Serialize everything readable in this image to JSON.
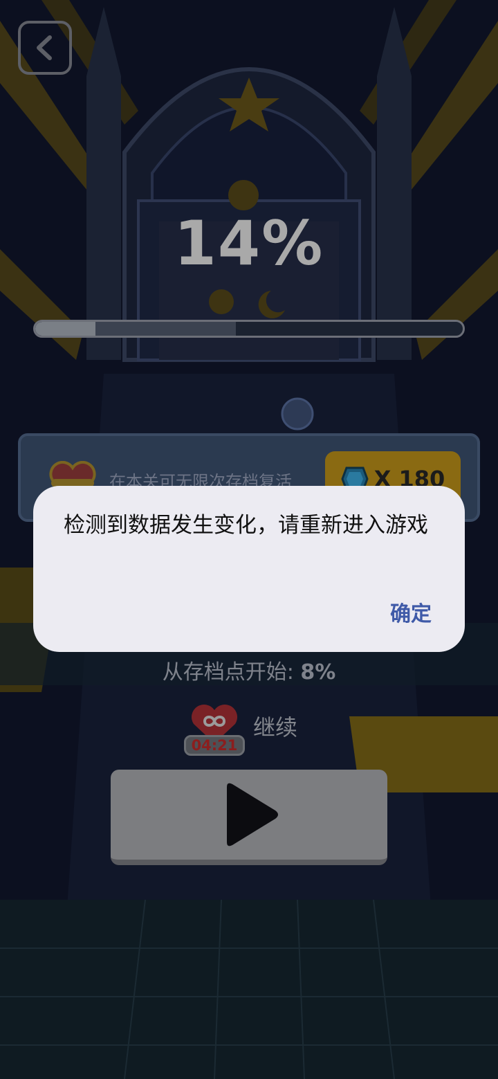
{
  "game": {
    "progress_text": "14%",
    "progress_value": 0.14,
    "checkpoint_value": 0.47,
    "revive_panel": {
      "description": "在本关可无限次存档复活",
      "gem_cost": "X 180",
      "gem_icon": "blue-gem-icon"
    },
    "checkpoint_prefix": "从存档点开始:",
    "checkpoint_percent": "8%",
    "continue": {
      "timer": "04:21",
      "label": "继续",
      "icon": "infinity-heart-icon"
    },
    "play_icon": "play-triangle-icon",
    "back_icon": "chevron-left-icon"
  },
  "dialog": {
    "message": "检测到数据发生变化，请重新进入游戏",
    "ok_label": "确定"
  },
  "colors": {
    "background": "#0b0f1e",
    "gold_accent": "#c99a1a",
    "dialog_bg": "#ecebf2",
    "dialog_button": "#3f5aa8"
  }
}
